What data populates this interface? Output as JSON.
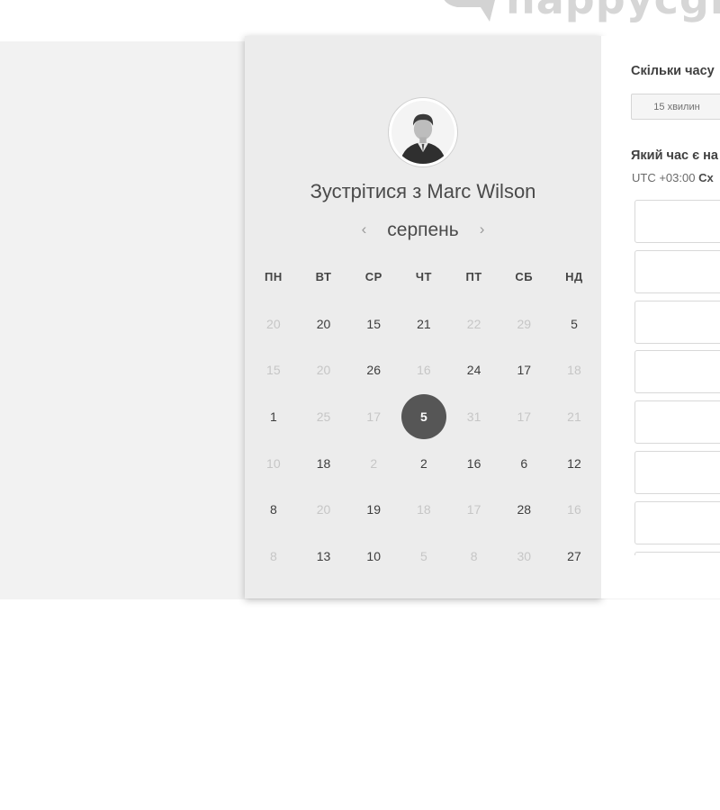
{
  "brand": {
    "logo_text": "happycgn"
  },
  "calendar": {
    "title_prefix": "Зустрітися з",
    "host_name": "Marc Wilson",
    "month": "серпень",
    "prev_arrow": "‹",
    "next_arrow": "›",
    "weekdays": [
      "ПН",
      "ВТ",
      "СР",
      "ЧТ",
      "ПТ",
      "СБ",
      "НД"
    ],
    "days": [
      {
        "label": "20",
        "state": "muted"
      },
      {
        "label": "20",
        "state": "available"
      },
      {
        "label": "15",
        "state": "available"
      },
      {
        "label": "21",
        "state": "available"
      },
      {
        "label": "22",
        "state": "muted"
      },
      {
        "label": "29",
        "state": "muted"
      },
      {
        "label": "5",
        "state": "available"
      },
      {
        "label": "15",
        "state": "muted"
      },
      {
        "label": "20",
        "state": "muted"
      },
      {
        "label": "26",
        "state": "available"
      },
      {
        "label": "16",
        "state": "muted"
      },
      {
        "label": "24",
        "state": "available"
      },
      {
        "label": "17",
        "state": "available"
      },
      {
        "label": "18",
        "state": "muted"
      },
      {
        "label": "1",
        "state": "available"
      },
      {
        "label": "25",
        "state": "muted"
      },
      {
        "label": "17",
        "state": "muted"
      },
      {
        "label": "5",
        "state": "selected"
      },
      {
        "label": "31",
        "state": "muted"
      },
      {
        "label": "17",
        "state": "muted"
      },
      {
        "label": "21",
        "state": "muted"
      },
      {
        "label": "10",
        "state": "muted"
      },
      {
        "label": "18",
        "state": "available"
      },
      {
        "label": "2",
        "state": "muted"
      },
      {
        "label": "2",
        "state": "available"
      },
      {
        "label": "16",
        "state": "available"
      },
      {
        "label": "6",
        "state": "available"
      },
      {
        "label": "12",
        "state": "available"
      },
      {
        "label": "8",
        "state": "available"
      },
      {
        "label": "20",
        "state": "muted"
      },
      {
        "label": "19",
        "state": "available"
      },
      {
        "label": "18",
        "state": "muted"
      },
      {
        "label": "17",
        "state": "muted"
      },
      {
        "label": "28",
        "state": "available"
      },
      {
        "label": "16",
        "state": "muted"
      },
      {
        "label": "8",
        "state": "muted"
      },
      {
        "label": "13",
        "state": "available"
      },
      {
        "label": "10",
        "state": "available"
      },
      {
        "label": "5",
        "state": "muted"
      },
      {
        "label": "8",
        "state": "muted"
      },
      {
        "label": "30",
        "state": "muted"
      },
      {
        "label": "27",
        "state": "available"
      }
    ]
  },
  "booking": {
    "duration_question": "Скільки часу",
    "duration_option": "15 хвилин",
    "time_question": "Який час є на",
    "timezone_offset": "UTC +03:00",
    "timezone_name": "Сх",
    "slot_count": 8
  }
}
